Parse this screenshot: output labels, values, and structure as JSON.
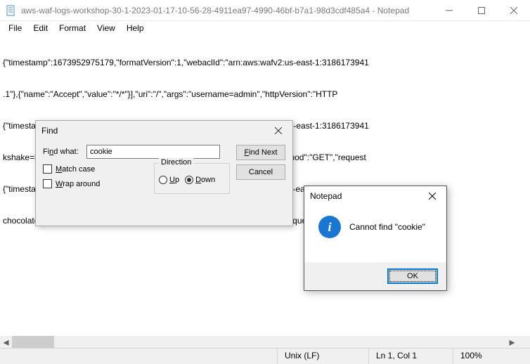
{
  "window": {
    "title": "aws-waf-logs-workshop-30-1-2023-01-17-10-56-28-4911ea97-4990-46bf-b7a1-98d3cdf485a4 - Notepad"
  },
  "menu": {
    "file": "File",
    "edit": "Edit",
    "format": "Format",
    "view": "View",
    "help": "Help"
  },
  "content": {
    "lines": [
      "{\"timestamp\":1673952975179,\"formatVersion\":1,\"webaclId\":\"arn:aws:wafv2:us-east-1:3186173941",
      ".1\"},{\"name\":\"Accept\",\"value\":\"*/*\"}],\"uri\":\"/\",\"args\":\"username=admin\",\"httpVersion\":\"HTTP",
      "{\"timestamp\":1673953099661,\"formatVersion\":1,\"webaclId\":\"arn:aws:wafv2:us-east-1:3186173941",
      "kshake=banana&favourite-topping=sauce\",\"httpVersion\":\"HTTP/1.1\",\"httpMethod\":\"GET\",\"request",
      "{\"timestamp\":1673953112701,\"formatVersion\":1,\"webaclId\":\"arn:aws:wafv2:us-east-1:3186173941",
      "chocolate\"}],\"uri\":\"/\",\"args\":\"\",\"httpVersion\":\"HTTP/1.1\",\"httpMethod\":\"GET\",\"requestId\":\""
    ]
  },
  "find": {
    "title": "Find",
    "label": "Find what:",
    "value": "cookie",
    "findnext_pre": "F",
    "findnext_post": "ind Next",
    "cancel": "Cancel",
    "direction": "Direction",
    "up_pre": "U",
    "up_post": "p",
    "down_pre": "D",
    "down_post": "own",
    "matchcase_pre": "M",
    "matchcase_post": "atch case",
    "wrap_pre": "W",
    "wrap_post": "rap around"
  },
  "alert": {
    "title": "Notepad",
    "message": "Cannot find \"cookie\"",
    "ok": "OK",
    "info_glyph": "i"
  },
  "status": {
    "encoding": "Unix (LF)",
    "position": "Ln 1, Col 1",
    "zoom": "100%"
  }
}
